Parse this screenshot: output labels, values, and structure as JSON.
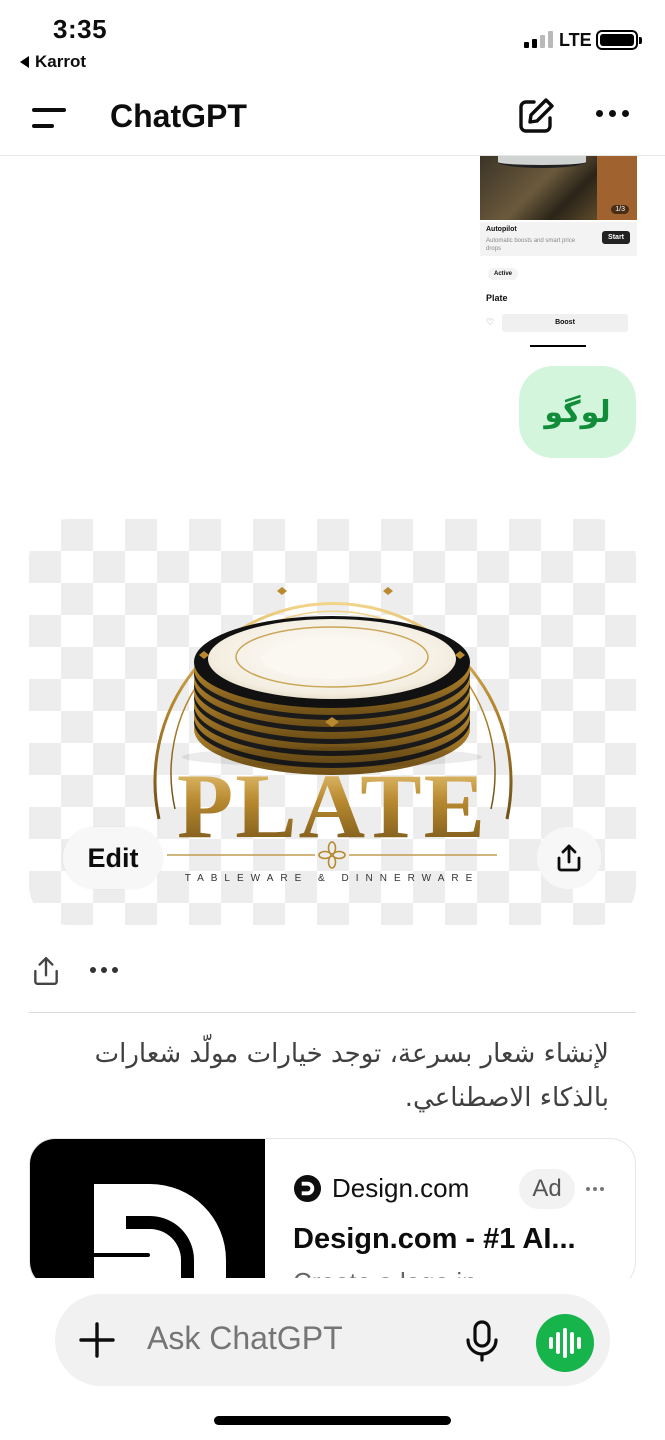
{
  "status_bar": {
    "time": "3:35",
    "back_app": "Karrot",
    "network": "LTE"
  },
  "header": {
    "title": "ChatGPT",
    "menu_icon": "hamburger-menu-icon",
    "compose_icon": "new-chat-icon",
    "more_icon": "more-horizontal-icon"
  },
  "thumbnail": {
    "counter": "1/3",
    "autopilot_title": "Autopilot",
    "autopilot_sub": "Automatic boosts and smart price drops",
    "start_label": "Start",
    "active_label": "Active",
    "item_name": "Plate",
    "boost_label": "Boost"
  },
  "user_message": "لوگو",
  "image_card": {
    "logo_text": "PLATE",
    "logo_tagline": "TABLEWARE & DINNERWARE",
    "edit_label": "Edit"
  },
  "assistant_answer": "لإنشاء شعار بسرعة، توجد خيارات مولّد شعارات بالذكاء الاصطناعي.",
  "ad": {
    "brand": "Design.com",
    "badge": "Ad",
    "title": "Design.com - #1 AI...",
    "description": "Create a logo in"
  },
  "composer": {
    "placeholder": "Ask ChatGPT"
  },
  "colors": {
    "accent_green": "#17b34b",
    "bubble_bg": "#d3f5dc",
    "bubble_text": "#118d3a",
    "gold": "#b8892f"
  }
}
